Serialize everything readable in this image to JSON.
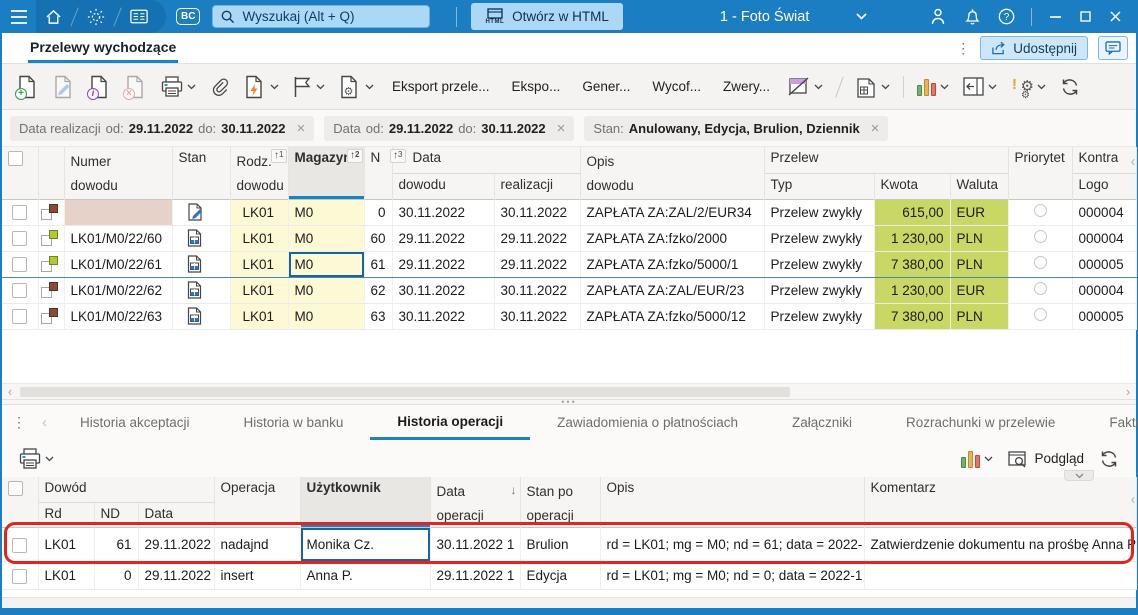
{
  "topbar": {
    "search_placeholder": "Wyszukaj (Alt + Q)",
    "bc_label": "BC",
    "html_icon_label": "HTML",
    "open_html_label": "Otwórz w HTML",
    "window_title": "1 - Foto Świat"
  },
  "page": {
    "tab_label": "Przelewy wychodzące",
    "share_label": "Udostępnij"
  },
  "toolbar": {
    "export1": "Eksport przele...",
    "export2": "Ekspo...",
    "gener": "Gener...",
    "wycof": "Wycof...",
    "zwery": "Zwery..."
  },
  "filters": {
    "f1_label": "Data realizacji",
    "f1_od_key": "od:",
    "f1_od_val": "29.11.2022",
    "f1_do_key": "do:",
    "f1_do_val": "30.11.2022",
    "f2_label": "Data",
    "f2_od_key": "od:",
    "f2_od_val": "29.11.2022",
    "f2_do_key": "do:",
    "f2_do_val": "30.11.2022",
    "f3_label": "Stan:",
    "f3_val": "Anulowany, Edycja, Brulion, Dziennik"
  },
  "grid": {
    "h": {
      "numer1": "Numer",
      "numer2": "dowodu",
      "stan": "Stan",
      "rodz1": "Rodz.",
      "rodz2": "dowodu",
      "rodz_sort": "1",
      "magazyn": "Magazyn",
      "magazyn_sort": "2",
      "n": "N",
      "n_sort": "3",
      "data": "Data",
      "data_dowodu": "dowodu",
      "data_realizacji": "realizacji",
      "opis1": "Opis",
      "opis2": "dowodu",
      "przelew": "Przelew",
      "typ": "Typ",
      "kwota": "Kwota",
      "waluta": "Waluta",
      "priorytet": "Priorytet",
      "kontra": "Kontra",
      "logo": "Logo"
    },
    "rows": [
      {
        "numer": "",
        "rodz": "LK01",
        "mag": "M0",
        "n": "0",
        "data_dow": "30.11.2022",
        "data_real": "30.11.2022",
        "opis": "ZAPŁATA ZA:ZAL/2/EUR34",
        "typ": "Przelew zwykły",
        "kwota": "615,00",
        "waluta": "EUR",
        "logo": "000004"
      },
      {
        "numer": "LK01/M0/22/60",
        "rodz": "LK01",
        "mag": "M0",
        "n": "60",
        "data_dow": "29.11.2022",
        "data_real": "29.11.2022",
        "opis": "ZAPŁATA ZA:fzko/2000",
        "typ": "Przelew zwykły",
        "kwota": "1 230,00",
        "waluta": "PLN",
        "logo": "000004"
      },
      {
        "numer": "LK01/M0/22/61",
        "rodz": "LK01",
        "mag": "M0",
        "n": "61",
        "data_dow": "29.11.2022",
        "data_real": "29.11.2022",
        "opis": "ZAPŁATA ZA:fzko/5000/1",
        "typ": "Przelew zwykły",
        "kwota": "7 380,00",
        "waluta": "PLN",
        "logo": "000005"
      },
      {
        "numer": "LK01/M0/22/62",
        "rodz": "LK01",
        "mag": "M0",
        "n": "62",
        "data_dow": "30.11.2022",
        "data_real": "30.11.2022",
        "opis": "ZAPŁATA ZA:ZAL/EUR/23",
        "typ": "Przelew zwykły",
        "kwota": "1 230,00",
        "waluta": "EUR",
        "logo": "000004"
      },
      {
        "numer": "LK01/M0/22/63",
        "rodz": "LK01",
        "mag": "M0",
        "n": "63",
        "data_dow": "30.11.2022",
        "data_real": "30.11.2022",
        "opis": "ZAPŁATA ZA:fzko/5000/12",
        "typ": "Przelew zwykły",
        "kwota": "7 380,00",
        "waluta": "PLN",
        "logo": "000005"
      }
    ]
  },
  "detail_tabs": {
    "t1": "Historia akceptacji",
    "t2": "Historia w banku",
    "t3": "Historia operacji",
    "t4": "Zawiadomienia o płatnościach",
    "t5": "Załączniki",
    "t6": "Rozrachunki w przelewie",
    "t7": "Faktury kos"
  },
  "detail_toolbar": {
    "preview_label": "Podgląd"
  },
  "history": {
    "h": {
      "dowod": "Dowód",
      "rd": "Rd",
      "nd": "ND",
      "data": "Data",
      "operacja": "Operacja",
      "uzytkownik": "Użytkownik",
      "dataop1": "Data",
      "dataop2": "operacji",
      "stanpo1": "Stan po",
      "stanpo2": "operacji",
      "opis": "Opis",
      "komentarz": "Komentarz"
    },
    "rows": [
      {
        "rd": "LK01",
        "nd": "61",
        "data": "29.11.2022",
        "operacja": "nadajnd",
        "uzytkownik": "Monika Cz.",
        "data_op": "30.11.2022 1",
        "stan_po": "Brulion",
        "opis": "rd = LK01; mg = M0; nd = 61; data = 2022-",
        "komentarz": "Zatwierdzenie dokumentu na prośbę Anna P"
      },
      {
        "rd": "LK01",
        "nd": "0",
        "data": "29.11.2022",
        "operacja": "insert",
        "uzytkownik": "Anna P.",
        "data_op": "29.11.2022 1",
        "stan_po": "Edycja",
        "opis": "rd = LK01; mg = M0; nd = 0; data = 2022-1",
        "komentarz": ""
      }
    ]
  },
  "colors": {
    "titlebar_blue": "#1b7dc2",
    "accent_blue": "#1585c8",
    "annotation_red": "#e4231e",
    "cell_yellow": "#fcf9d4",
    "cell_green": "#c9d765",
    "cell_pink": "#e7d2ca"
  }
}
